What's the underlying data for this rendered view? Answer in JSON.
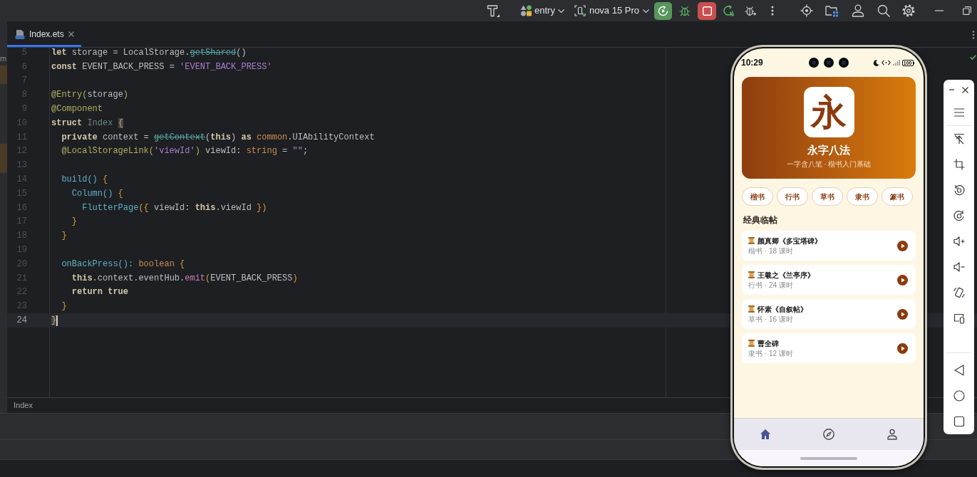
{
  "toolbar": {
    "run_configuration": "entry",
    "device": "nova 15 Pro"
  },
  "left_strip": {
    "label": "m"
  },
  "editor": {
    "tabs": [
      {
        "label": "Index.ets",
        "selected": true
      }
    ],
    "lines": [
      {
        "number": "5",
        "current": false,
        "tokens": [
          {
            "text": "let",
            "kind": "keyword"
          },
          {
            "text": " storage = LocalStorage.",
            "kind": "plain"
          },
          {
            "text": "getShared",
            "kind": "deprecated"
          },
          {
            "text": "()",
            "kind": "plain"
          }
        ]
      },
      {
        "number": "6",
        "current": false,
        "tokens": [
          {
            "text": "const",
            "kind": "keyword"
          },
          {
            "text": " EVENT_BACK_PRESS = ",
            "kind": "plain"
          },
          {
            "text": "'EVENT_BACK_PRESS'",
            "kind": "string"
          }
        ]
      },
      {
        "number": "7",
        "current": false
      },
      {
        "number": "8",
        "current": false,
        "tokens": [
          {
            "text": "@Entry(",
            "kind": "decorator"
          },
          {
            "text": "storage",
            "kind": "plain"
          },
          {
            "text": ")",
            "kind": "decorator"
          }
        ]
      },
      {
        "number": "9",
        "current": false,
        "tokens": [
          {
            "text": "@Component",
            "kind": "decorator"
          }
        ]
      },
      {
        "number": "10",
        "current": false,
        "tokens": [
          {
            "text": "struct ",
            "kind": "keyword"
          },
          {
            "text": "Index ",
            "kind": "unused"
          },
          {
            "text": "{",
            "kind": "matched_brace"
          }
        ]
      },
      {
        "number": "11",
        "current": false,
        "tokens": [
          {
            "text": "  private",
            "kind": "keyword"
          },
          {
            "text": " context = ",
            "kind": "plain"
          },
          {
            "text": "getContext",
            "kind": "deprecated"
          },
          {
            "text": "(",
            "kind": "plain"
          },
          {
            "text": "this",
            "kind": "keyword"
          },
          {
            "text": ") ",
            "kind": "plain"
          },
          {
            "text": "as ",
            "kind": "keyword"
          },
          {
            "text": "common",
            "kind": "type"
          },
          {
            "text": ".UIAbilityContext",
            "kind": "plain"
          }
        ]
      },
      {
        "number": "12",
        "current": false,
        "tokens": [
          {
            "text": "  @LocalStorageLink(",
            "kind": "decorator"
          },
          {
            "text": "'viewId'",
            "kind": "string"
          },
          {
            "text": ")",
            "kind": "decorator"
          },
          {
            "text": " viewId: ",
            "kind": "plain"
          },
          {
            "text": "string",
            "kind": "type"
          },
          {
            "text": " = ",
            "kind": "plain"
          },
          {
            "text": "\"\"",
            "kind": "string"
          },
          {
            "text": ";",
            "kind": "plain"
          }
        ]
      },
      {
        "number": "13",
        "current": false
      },
      {
        "number": "14",
        "current": false,
        "tokens": [
          {
            "text": "  build()",
            "kind": "function"
          },
          {
            "text": " {",
            "kind": "brace"
          }
        ]
      },
      {
        "number": "15",
        "current": false,
        "tokens": [
          {
            "text": "    Column()",
            "kind": "function"
          },
          {
            "text": " {",
            "kind": "brace"
          }
        ]
      },
      {
        "number": "16",
        "current": false,
        "tokens": [
          {
            "text": "      FlutterPage",
            "kind": "function"
          },
          {
            "text": "({",
            "kind": "brace"
          },
          {
            "text": " viewId: ",
            "kind": "plain"
          },
          {
            "text": "this",
            "kind": "keyword"
          },
          {
            "text": ".viewId ",
            "kind": "plain"
          },
          {
            "text": "})",
            "kind": "brace"
          }
        ]
      },
      {
        "number": "17",
        "current": false,
        "tokens": [
          {
            "text": "    }",
            "kind": "brace"
          }
        ]
      },
      {
        "number": "18",
        "current": false,
        "tokens": [
          {
            "text": "  }",
            "kind": "brace"
          }
        ]
      },
      {
        "number": "19",
        "current": false
      },
      {
        "number": "20",
        "current": false,
        "tokens": [
          {
            "text": "  onBackPress():",
            "kind": "function"
          },
          {
            "text": " boolean",
            "kind": "type"
          },
          {
            "text": " {",
            "kind": "brace"
          }
        ]
      },
      {
        "number": "21",
        "current": false,
        "tokens": [
          {
            "text": "    this",
            "kind": "keyword"
          },
          {
            "text": ".context.eventHub.",
            "kind": "plain"
          },
          {
            "text": "emit",
            "kind": "method"
          },
          {
            "text": "(",
            "kind": "brace"
          },
          {
            "text": "EVENT_BACK_PRESS",
            "kind": "plain"
          },
          {
            "text": ")",
            "kind": "brace"
          }
        ]
      },
      {
        "number": "22",
        "current": false,
        "tokens": [
          {
            "text": "    return true",
            "kind": "keyword"
          }
        ]
      },
      {
        "number": "23",
        "current": false,
        "tokens": [
          {
            "text": "  }",
            "kind": "brace"
          }
        ]
      },
      {
        "number": "24",
        "current": true,
        "tokens": [
          {
            "text": "}",
            "kind": "matched_brace"
          }
        ]
      }
    ],
    "breadcrumb": "Index"
  },
  "emulator": {
    "status_bar": {
      "time": "10:29",
      "battery": "100"
    },
    "hero": {
      "glyph": "永",
      "title": "永字八法",
      "subtitle": "一字含八笔 · 楷书入门基础"
    },
    "categories": [
      "楷书",
      "行书",
      "草书",
      "隶书",
      "篆书"
    ],
    "section_title": "经典临帖",
    "lessons": [
      {
        "title": "颜真卿《多宝塔碑》",
        "meta": "楷书 · 18 课时"
      },
      {
        "title": "王羲之《兰亭序》",
        "meta": "行书 · 24 课时"
      },
      {
        "title": "怀素《自叙帖》",
        "meta": "草书 · 16 课时"
      },
      {
        "title": "曹全碑",
        "meta": "隶书 · 12 课时"
      }
    ],
    "nav": [
      {
        "kind": "home",
        "selected": true
      },
      {
        "kind": "discover",
        "selected": false
      },
      {
        "kind": "profile",
        "selected": false
      }
    ]
  }
}
